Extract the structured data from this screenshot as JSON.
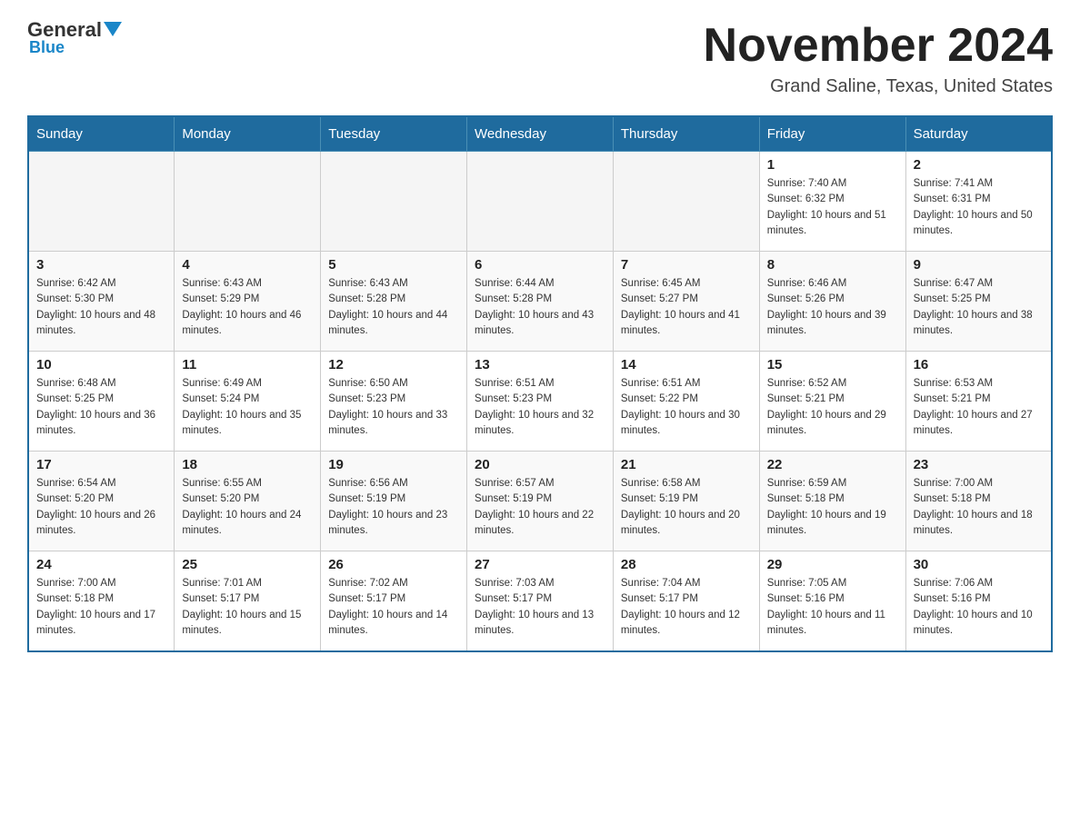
{
  "logo": {
    "general": "General",
    "blue": "Blue"
  },
  "title": "November 2024",
  "location": "Grand Saline, Texas, United States",
  "days_of_week": [
    "Sunday",
    "Monday",
    "Tuesday",
    "Wednesday",
    "Thursday",
    "Friday",
    "Saturday"
  ],
  "weeks": [
    [
      {
        "day": "",
        "sunrise": "",
        "sunset": "",
        "daylight": ""
      },
      {
        "day": "",
        "sunrise": "",
        "sunset": "",
        "daylight": ""
      },
      {
        "day": "",
        "sunrise": "",
        "sunset": "",
        "daylight": ""
      },
      {
        "day": "",
        "sunrise": "",
        "sunset": "",
        "daylight": ""
      },
      {
        "day": "",
        "sunrise": "",
        "sunset": "",
        "daylight": ""
      },
      {
        "day": "1",
        "sunrise": "Sunrise: 7:40 AM",
        "sunset": "Sunset: 6:32 PM",
        "daylight": "Daylight: 10 hours and 51 minutes."
      },
      {
        "day": "2",
        "sunrise": "Sunrise: 7:41 AM",
        "sunset": "Sunset: 6:31 PM",
        "daylight": "Daylight: 10 hours and 50 minutes."
      }
    ],
    [
      {
        "day": "3",
        "sunrise": "Sunrise: 6:42 AM",
        "sunset": "Sunset: 5:30 PM",
        "daylight": "Daylight: 10 hours and 48 minutes."
      },
      {
        "day": "4",
        "sunrise": "Sunrise: 6:43 AM",
        "sunset": "Sunset: 5:29 PM",
        "daylight": "Daylight: 10 hours and 46 minutes."
      },
      {
        "day": "5",
        "sunrise": "Sunrise: 6:43 AM",
        "sunset": "Sunset: 5:28 PM",
        "daylight": "Daylight: 10 hours and 44 minutes."
      },
      {
        "day": "6",
        "sunrise": "Sunrise: 6:44 AM",
        "sunset": "Sunset: 5:28 PM",
        "daylight": "Daylight: 10 hours and 43 minutes."
      },
      {
        "day": "7",
        "sunrise": "Sunrise: 6:45 AM",
        "sunset": "Sunset: 5:27 PM",
        "daylight": "Daylight: 10 hours and 41 minutes."
      },
      {
        "day": "8",
        "sunrise": "Sunrise: 6:46 AM",
        "sunset": "Sunset: 5:26 PM",
        "daylight": "Daylight: 10 hours and 39 minutes."
      },
      {
        "day": "9",
        "sunrise": "Sunrise: 6:47 AM",
        "sunset": "Sunset: 5:25 PM",
        "daylight": "Daylight: 10 hours and 38 minutes."
      }
    ],
    [
      {
        "day": "10",
        "sunrise": "Sunrise: 6:48 AM",
        "sunset": "Sunset: 5:25 PM",
        "daylight": "Daylight: 10 hours and 36 minutes."
      },
      {
        "day": "11",
        "sunrise": "Sunrise: 6:49 AM",
        "sunset": "Sunset: 5:24 PM",
        "daylight": "Daylight: 10 hours and 35 minutes."
      },
      {
        "day": "12",
        "sunrise": "Sunrise: 6:50 AM",
        "sunset": "Sunset: 5:23 PM",
        "daylight": "Daylight: 10 hours and 33 minutes."
      },
      {
        "day": "13",
        "sunrise": "Sunrise: 6:51 AM",
        "sunset": "Sunset: 5:23 PM",
        "daylight": "Daylight: 10 hours and 32 minutes."
      },
      {
        "day": "14",
        "sunrise": "Sunrise: 6:51 AM",
        "sunset": "Sunset: 5:22 PM",
        "daylight": "Daylight: 10 hours and 30 minutes."
      },
      {
        "day": "15",
        "sunrise": "Sunrise: 6:52 AM",
        "sunset": "Sunset: 5:21 PM",
        "daylight": "Daylight: 10 hours and 29 minutes."
      },
      {
        "day": "16",
        "sunrise": "Sunrise: 6:53 AM",
        "sunset": "Sunset: 5:21 PM",
        "daylight": "Daylight: 10 hours and 27 minutes."
      }
    ],
    [
      {
        "day": "17",
        "sunrise": "Sunrise: 6:54 AM",
        "sunset": "Sunset: 5:20 PM",
        "daylight": "Daylight: 10 hours and 26 minutes."
      },
      {
        "day": "18",
        "sunrise": "Sunrise: 6:55 AM",
        "sunset": "Sunset: 5:20 PM",
        "daylight": "Daylight: 10 hours and 24 minutes."
      },
      {
        "day": "19",
        "sunrise": "Sunrise: 6:56 AM",
        "sunset": "Sunset: 5:19 PM",
        "daylight": "Daylight: 10 hours and 23 minutes."
      },
      {
        "day": "20",
        "sunrise": "Sunrise: 6:57 AM",
        "sunset": "Sunset: 5:19 PM",
        "daylight": "Daylight: 10 hours and 22 minutes."
      },
      {
        "day": "21",
        "sunrise": "Sunrise: 6:58 AM",
        "sunset": "Sunset: 5:19 PM",
        "daylight": "Daylight: 10 hours and 20 minutes."
      },
      {
        "day": "22",
        "sunrise": "Sunrise: 6:59 AM",
        "sunset": "Sunset: 5:18 PM",
        "daylight": "Daylight: 10 hours and 19 minutes."
      },
      {
        "day": "23",
        "sunrise": "Sunrise: 7:00 AM",
        "sunset": "Sunset: 5:18 PM",
        "daylight": "Daylight: 10 hours and 18 minutes."
      }
    ],
    [
      {
        "day": "24",
        "sunrise": "Sunrise: 7:00 AM",
        "sunset": "Sunset: 5:18 PM",
        "daylight": "Daylight: 10 hours and 17 minutes."
      },
      {
        "day": "25",
        "sunrise": "Sunrise: 7:01 AM",
        "sunset": "Sunset: 5:17 PM",
        "daylight": "Daylight: 10 hours and 15 minutes."
      },
      {
        "day": "26",
        "sunrise": "Sunrise: 7:02 AM",
        "sunset": "Sunset: 5:17 PM",
        "daylight": "Daylight: 10 hours and 14 minutes."
      },
      {
        "day": "27",
        "sunrise": "Sunrise: 7:03 AM",
        "sunset": "Sunset: 5:17 PM",
        "daylight": "Daylight: 10 hours and 13 minutes."
      },
      {
        "day": "28",
        "sunrise": "Sunrise: 7:04 AM",
        "sunset": "Sunset: 5:17 PM",
        "daylight": "Daylight: 10 hours and 12 minutes."
      },
      {
        "day": "29",
        "sunrise": "Sunrise: 7:05 AM",
        "sunset": "Sunset: 5:16 PM",
        "daylight": "Daylight: 10 hours and 11 minutes."
      },
      {
        "day": "30",
        "sunrise": "Sunrise: 7:06 AM",
        "sunset": "Sunset: 5:16 PM",
        "daylight": "Daylight: 10 hours and 10 minutes."
      }
    ]
  ]
}
